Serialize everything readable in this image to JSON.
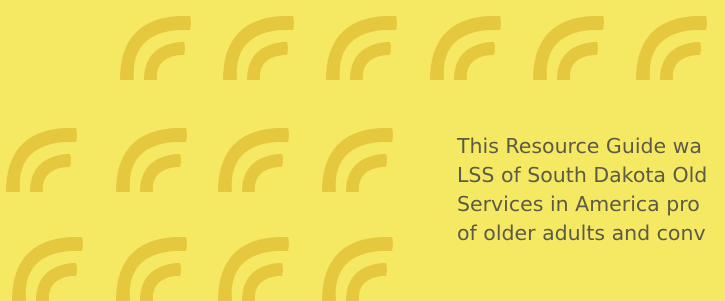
{
  "colors": {
    "background": "#f5e862",
    "pattern": "#e6c83f",
    "text": "#5b5b46"
  },
  "pattern": {
    "icon": "signal-arc-icon"
  },
  "body": {
    "lines": [
      "This Resource Guide wa",
      "LSS of South Dakota Old",
      "Services in America pro",
      "of older adults and conv"
    ]
  }
}
